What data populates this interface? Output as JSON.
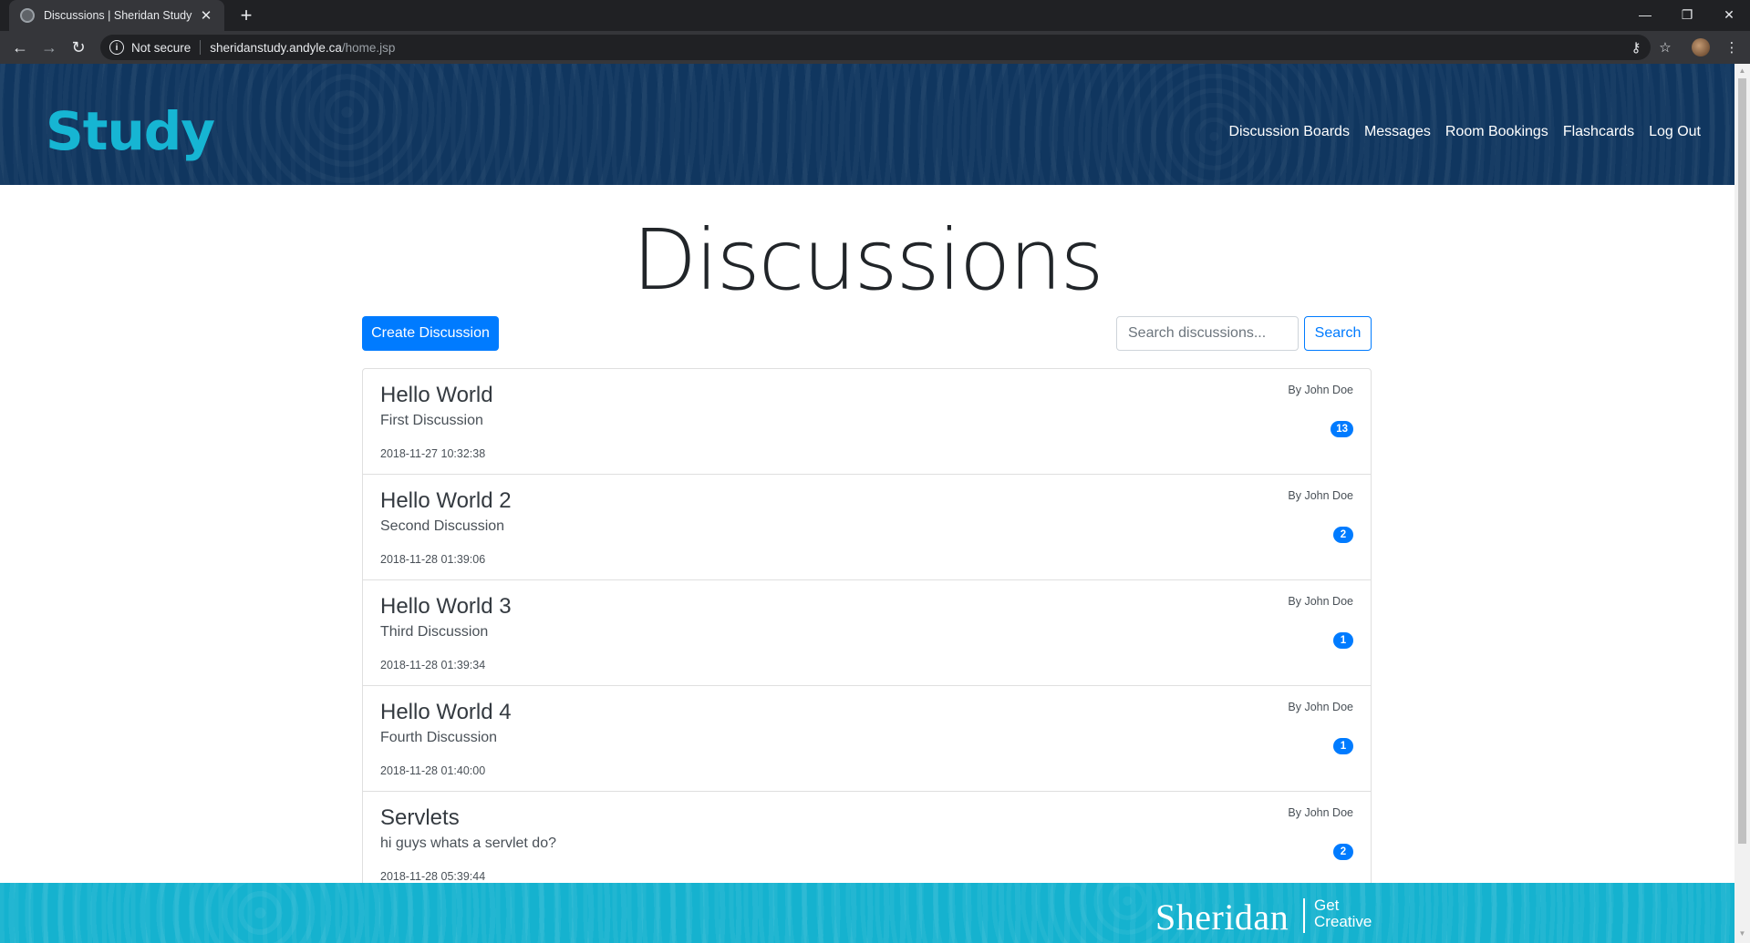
{
  "browser": {
    "tab_title": "Discussions | Sheridan Study",
    "tab_close": "✕",
    "new_tab": "+",
    "security_label": "Not secure",
    "url_host": "sheridanstudy.andyle.ca",
    "url_path": "/home.jsp",
    "icons": {
      "back": "←",
      "forward": "→",
      "reload": "↻",
      "info": "i",
      "key": "⚷",
      "star": "☆",
      "menu": "⋮",
      "minimize": "—",
      "restore": "❐",
      "close": "✕"
    }
  },
  "site": {
    "brand": "Study",
    "nav": [
      "Discussion Boards",
      "Messages",
      "Room Bookings",
      "Flashcards",
      "Log Out"
    ]
  },
  "main": {
    "title": "Discussions",
    "create_button": "Create Discussion",
    "search_placeholder": "Search discussions...",
    "search_button": "Search",
    "discussions": [
      {
        "title": "Hello World",
        "description": "First Discussion",
        "timestamp": "2018-11-27 10:32:38",
        "author": "By John Doe",
        "count": "13"
      },
      {
        "title": "Hello World 2",
        "description": "Second Discussion",
        "timestamp": "2018-11-28 01:39:06",
        "author": "By John Doe",
        "count": "2"
      },
      {
        "title": "Hello World 3",
        "description": "Third Discussion",
        "timestamp": "2018-11-28 01:39:34",
        "author": "By John Doe",
        "count": "1"
      },
      {
        "title": "Hello World 4",
        "description": "Fourth Discussion",
        "timestamp": "2018-11-28 01:40:00",
        "author": "By John Doe",
        "count": "1"
      },
      {
        "title": "Servlets",
        "description": "hi guys whats a servlet do?",
        "timestamp": "2018-11-28 05:39:44",
        "author": "By John Doe",
        "count": "2"
      }
    ]
  },
  "footer": {
    "brand": "Sheridan",
    "tagline": "Get Creative"
  },
  "colors": {
    "header_bg": "#10365f",
    "brand_accent": "#16b5d3",
    "primary": "#007bff",
    "footer_bg": "#15b2cf"
  }
}
